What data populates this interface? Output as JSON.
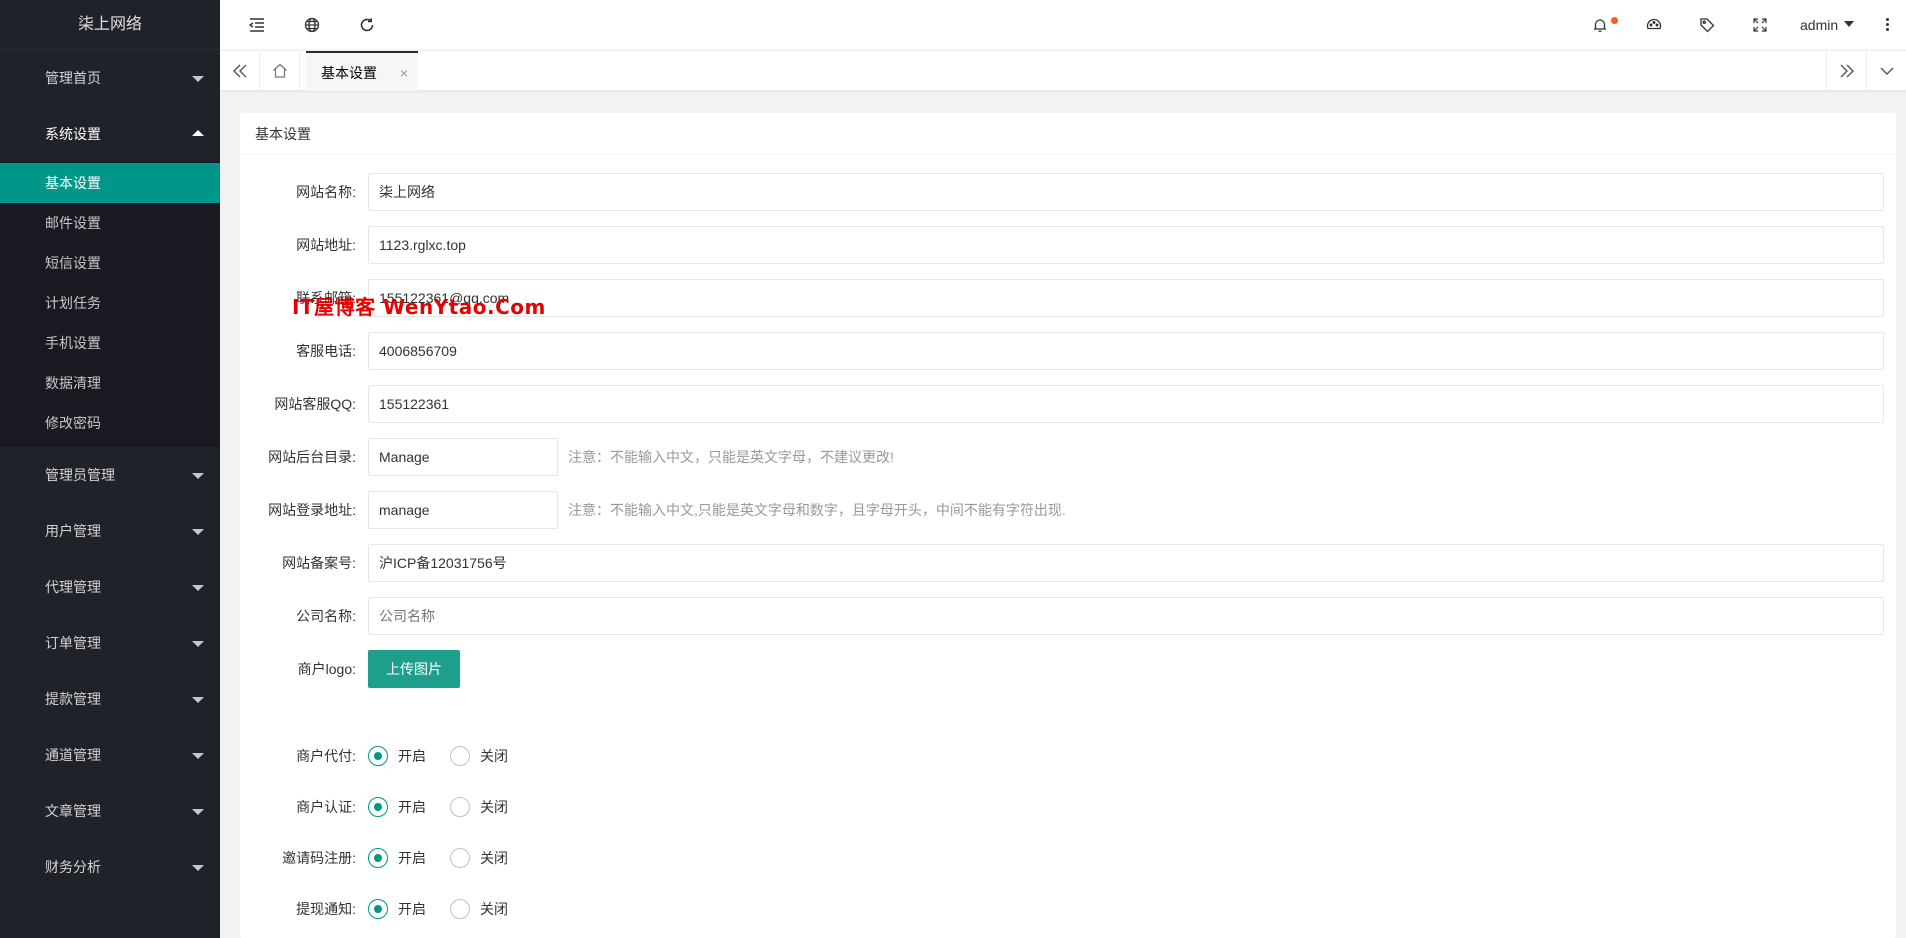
{
  "app": {
    "logo": "柒上网络"
  },
  "sidebar": {
    "groups": [
      {
        "label": "管理首页"
      },
      {
        "label": "系统设置",
        "items": [
          "基本设置",
          "邮件设置",
          "短信设置",
          "计划任务",
          "手机设置",
          "数据清理",
          "修改密码"
        ]
      },
      {
        "label": "管理员管理"
      },
      {
        "label": "用户管理"
      },
      {
        "label": "代理管理"
      },
      {
        "label": "订单管理"
      },
      {
        "label": "提款管理"
      },
      {
        "label": "通道管理"
      },
      {
        "label": "文章管理"
      },
      {
        "label": "财务分析"
      }
    ]
  },
  "header": {
    "user": "admin",
    "icons": [
      "menu-fold-icon",
      "globe-icon",
      "refresh-icon",
      "bell-icon",
      "theme-icon",
      "tag-icon",
      "fullscreen-icon",
      "more-icon"
    ]
  },
  "tabs": {
    "active": "基本设置",
    "close": "×"
  },
  "card": {
    "title": "基本设置"
  },
  "form": {
    "site_name": {
      "label": "网站名称:",
      "value": "柒上网络"
    },
    "site_url": {
      "label": "网站地址:",
      "value": "1123.rglxc.top"
    },
    "contact_email": {
      "label": "联系邮箱:",
      "value": "155122361@qq.com"
    },
    "service_phone": {
      "label": "客服电话:",
      "value": "4006856709"
    },
    "service_qq": {
      "label": "网站客服QQ:",
      "value": "155122361"
    },
    "admin_dir": {
      "label": "网站后台目录:",
      "value": "Manage",
      "tip": "注意：不能输入中文，只能是英文字母，不建议更改!"
    },
    "login_path": {
      "label": "网站登录地址:",
      "value": "manage",
      "tip": "注意：不能输入中文,只能是英文字母和数字，且字母开头，中间不能有字符出现."
    },
    "icp": {
      "label": "网站备案号:",
      "value": "沪ICP备12031756号"
    },
    "company": {
      "label": "公司名称:",
      "value": "",
      "placeholder": "公司名称"
    },
    "logo": {
      "label": "商户logo:",
      "button": "上传图片"
    },
    "radios": [
      {
        "label": "商户代付:",
        "on": "开启",
        "off": "关闭",
        "selected": "on"
      },
      {
        "label": "商户认证:",
        "on": "开启",
        "off": "关闭",
        "selected": "on"
      },
      {
        "label": "邀请码注册:",
        "on": "开启",
        "off": "关闭",
        "selected": "on"
      },
      {
        "label": "提现通知:",
        "on": "开启",
        "off": "关闭",
        "selected": "on"
      }
    ]
  },
  "watermark": "IT屋博客 WenYtao.Com",
  "colors": {
    "sidebar": "#20222a",
    "active": "#009688",
    "notify": "#ff5722"
  }
}
